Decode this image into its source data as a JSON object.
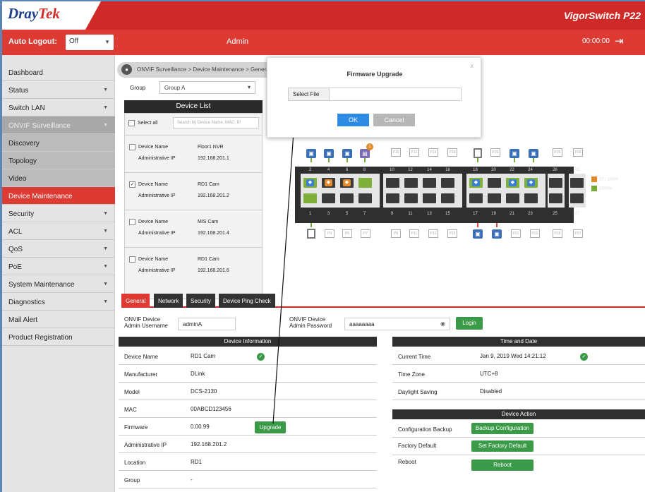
{
  "header": {
    "logo_main": "Dray",
    "logo_accent": "Tek",
    "model": "VigorSwitch P22"
  },
  "bar": {
    "auto_logout_label": "Auto Logout:",
    "auto_logout_value": "Off",
    "user": "Admin",
    "timer": "00:00:00"
  },
  "sidebar": {
    "items": [
      {
        "label": "Dashboard"
      },
      {
        "label": "Status"
      },
      {
        "label": "Switch LAN"
      },
      {
        "label": "ONVIF Surveillance"
      },
      {
        "label": "Discovery"
      },
      {
        "label": "Topology"
      },
      {
        "label": "Video"
      },
      {
        "label": "Device Maintenance"
      },
      {
        "label": "Security"
      },
      {
        "label": "ACL"
      },
      {
        "label": "QoS"
      },
      {
        "label": "PoE"
      },
      {
        "label": "System Maintenance"
      },
      {
        "label": "Diagnostics"
      },
      {
        "label": "Mail Alert"
      },
      {
        "label": "Product Registration"
      }
    ]
  },
  "breadcrumb": "ONVIF Surveillance > Device Maintenance > General",
  "group": {
    "label": "Group",
    "value": "Group A"
  },
  "device_list": {
    "title": "Device List",
    "select_all": "Select all",
    "search_placeholder": "Search by Device Name, MAC, IP",
    "devices": [
      {
        "name_label": "Device Name",
        "name": "Floor1 NVR",
        "ip_label": "Administrative IP",
        "ip": "192.168.201.1",
        "checked": false
      },
      {
        "name_label": "Device Name",
        "name": "RD1 Cam",
        "ip_label": "Administrative IP",
        "ip": "192.168.201.2",
        "checked": true
      },
      {
        "name_label": "Device Name",
        "name": "MIS Cam",
        "ip_label": "Administrative IP",
        "ip": "192.168.201.4",
        "checked": false
      },
      {
        "name_label": "Device Name",
        "name": "RD1 Cam",
        "ip_label": "Administrative IP",
        "ip": "192.168.201.6",
        "checked": false
      }
    ]
  },
  "switch": {
    "top_numbers": [
      "2",
      "4",
      "6",
      "8",
      "10",
      "12",
      "14",
      "16",
      "18",
      "20",
      "22",
      "24",
      "26",
      "28"
    ],
    "bottom_numbers": [
      "1",
      "3",
      "5",
      "7",
      "9",
      "11",
      "13",
      "15",
      "17",
      "19",
      "21",
      "23",
      "25",
      "27"
    ],
    "top_labels": [
      "P10",
      "P12",
      "P14",
      "P16",
      "P20",
      "P26",
      "P28"
    ],
    "bottom_labels": [
      "P3",
      "P5",
      "P7",
      "P9",
      "P11",
      "P13",
      "P15",
      "P21",
      "P23",
      "P25",
      "P27"
    ],
    "badge": "1",
    "legend": [
      {
        "label": "10 / 100m",
        "color": "#e58a2c"
      },
      {
        "label": "1000m",
        "color": "#74ac35"
      }
    ]
  },
  "tabs": [
    {
      "label": "General"
    },
    {
      "label": "Network"
    },
    {
      "label": "Security"
    },
    {
      "label": "Device Ping Check"
    }
  ],
  "credentials": {
    "user_label": "ONVIF Device Admin Username",
    "user_value": "adminA",
    "pass_label": "ONVIF Device Admin Password",
    "pass_value": "aaaaaaaa",
    "login": "Login"
  },
  "device_info": {
    "title": "Device Information",
    "rows": [
      {
        "k": "Device Name",
        "v": "RD1 Cam"
      },
      {
        "k": "Manufacturer",
        "v": "DLink"
      },
      {
        "k": "Model",
        "v": "DCS-2130"
      },
      {
        "k": "MAC",
        "v": "00ABCD123456"
      },
      {
        "k": "Firmware",
        "v": "0.00.99"
      },
      {
        "k": "Administrative IP",
        "v": "192.168.201.2"
      },
      {
        "k": "Location",
        "v": "RD1"
      },
      {
        "k": "Group",
        "v": "-"
      }
    ],
    "upgrade": "Upgrade"
  },
  "time_date": {
    "title": "Time and Date",
    "rows": [
      {
        "k": "Current Time",
        "v": "Jan 9, 2019 Wed 14:21:12"
      },
      {
        "k": "Time Zone",
        "v": "UTC+8"
      },
      {
        "k": "Daylight Saving",
        "v": "Disabled"
      }
    ]
  },
  "device_action": {
    "title": "Device Action",
    "rows": [
      {
        "k": "Configuration Backup",
        "btn": "Backup Configuration"
      },
      {
        "k": "Factory Default",
        "btn": "Set Factory Default"
      },
      {
        "k": "Reboot",
        "btn": "Reboot"
      }
    ]
  },
  "modal": {
    "title": "Firmware Upgrade",
    "close": "x",
    "select_file": "Select File",
    "file_value": "",
    "ok": "OK",
    "cancel": "Cancel"
  }
}
